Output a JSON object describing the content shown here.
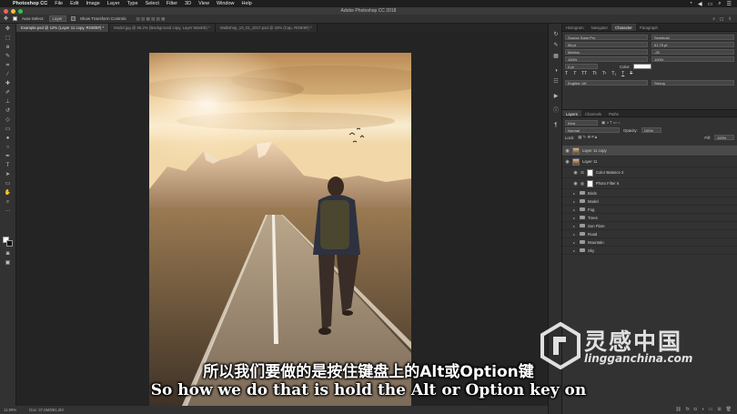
{
  "menubar": {
    "app": "Photoshop CC",
    "items": [
      "File",
      "Edit",
      "Image",
      "Layer",
      "Type",
      "Select",
      "Filter",
      "3D",
      "View",
      "Window",
      "Help"
    ]
  },
  "window": {
    "title": "Adobe Photoshop CC 2018"
  },
  "options_bar": {
    "auto_select": "Auto-Select:",
    "auto_select_value": "Layer",
    "show_transform": "Show Transform Controls"
  },
  "tabs": [
    {
      "label": "Example.psd @ 12% (Layer 11 copy, RGB/8#) *",
      "active": true
    },
    {
      "label": "Model.jpg @ 66.2% (Background copy, Layer Mask/8) *",
      "active": false
    },
    {
      "label": "Walkshop_10_01_2017.psd @ 33% (Cap, RGB/8#) *",
      "active": false
    }
  ],
  "status": {
    "zoom": "11.99%",
    "doc": "Doc: 37.6M/881.2M"
  },
  "panel_tabs": [
    "Histogram",
    "Navigator",
    "Character",
    "Paragraph"
  ],
  "active_panel_tab": "Character",
  "character": {
    "font_family": "Source Sans Pro",
    "font_style": "Semibold",
    "size": "58 pt",
    "leading": "61.75 pt",
    "kerning": "Metrics",
    "tracking": "-25",
    "vscale": "100%",
    "hscale": "100%",
    "baseline": "0 pt",
    "color_label": "Color:",
    "language": "English: UK",
    "antialias": "Strong"
  },
  "layers_tabs": [
    "Layers",
    "Channels",
    "Paths"
  ],
  "layer_controls": {
    "kind": "Kind",
    "blend": "Normal",
    "opacity_label": "Opacity:",
    "opacity": "100%",
    "lock_label": "Lock:",
    "fill_label": "Fill:",
    "fill": "100%"
  },
  "layers": [
    {
      "name": "Layer 11 copy",
      "type": "pixel",
      "selected": true
    },
    {
      "name": "Layer 11",
      "type": "pixel",
      "selected": false
    },
    {
      "name": "Color Balance 2",
      "type": "adjustment",
      "selected": false
    },
    {
      "name": "Photo Filter 6",
      "type": "adjustment",
      "selected": false
    },
    {
      "name": "Birds",
      "type": "group",
      "selected": false
    },
    {
      "name": "Model",
      "type": "group",
      "selected": false
    },
    {
      "name": "Fog",
      "type": "group",
      "selected": false
    },
    {
      "name": "Trees",
      "type": "group",
      "selected": false
    },
    {
      "name": "Sun Flare",
      "type": "group",
      "selected": false
    },
    {
      "name": "Road",
      "type": "group",
      "selected": false
    },
    {
      "name": "Mountain",
      "type": "group",
      "selected": false
    },
    {
      "name": "Sky",
      "type": "group",
      "selected": false
    }
  ],
  "subtitles": {
    "zh": "所以我们要做的是按住键盘上的Alt或Option键",
    "en": "So how we do that is hold the Alt or Option key on"
  },
  "watermark": {
    "name": "灵感中国",
    "url": "lingganchina.com"
  },
  "icons": {
    "tools": [
      "move-icon",
      "marquee-icon",
      "lasso-icon",
      "quick-select-icon",
      "crop-icon",
      "eyedropper-icon",
      "healing-icon",
      "brush-icon",
      "stamp-icon",
      "history-brush-icon",
      "eraser-icon",
      "gradient-icon",
      "blur-icon",
      "dodge-icon",
      "pen-icon",
      "type-icon",
      "path-select-icon",
      "shape-icon",
      "hand-icon",
      "zoom-icon"
    ]
  },
  "colors": {
    "accent": "#31a8ff",
    "panel_bg": "#323232",
    "canvas_bg": "#242424"
  }
}
